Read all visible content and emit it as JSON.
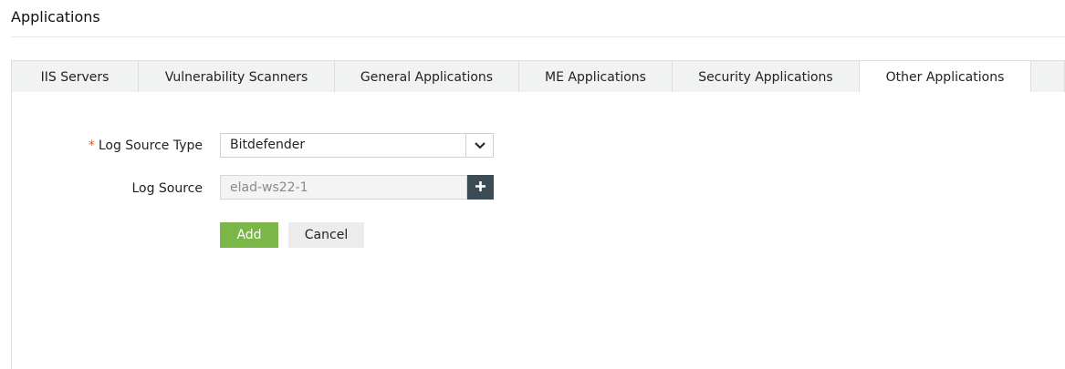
{
  "page": {
    "title": "Applications"
  },
  "tabs": [
    {
      "label": "IIS Servers",
      "active": false
    },
    {
      "label": "Vulnerability Scanners",
      "active": false
    },
    {
      "label": "General Applications",
      "active": false
    },
    {
      "label": "ME Applications",
      "active": false
    },
    {
      "label": "Security Applications",
      "active": false
    },
    {
      "label": "Other Applications",
      "active": true
    }
  ],
  "form": {
    "log_source_type": {
      "required_mark": "*",
      "label": "Log Source Type",
      "value": "Bitdefender",
      "icon": "chevron-down-icon"
    },
    "log_source": {
      "label": "Log Source",
      "value": "elad-ws22-1",
      "add_icon": "plus-icon"
    }
  },
  "buttons": {
    "add_label": "Add",
    "cancel_label": "Cancel"
  },
  "colors": {
    "accent_green": "#7ab648",
    "required_mark": "#e35d2a",
    "plus_button_bg": "#3d4b54",
    "tab_bar_bg": "#f1f2f2"
  }
}
